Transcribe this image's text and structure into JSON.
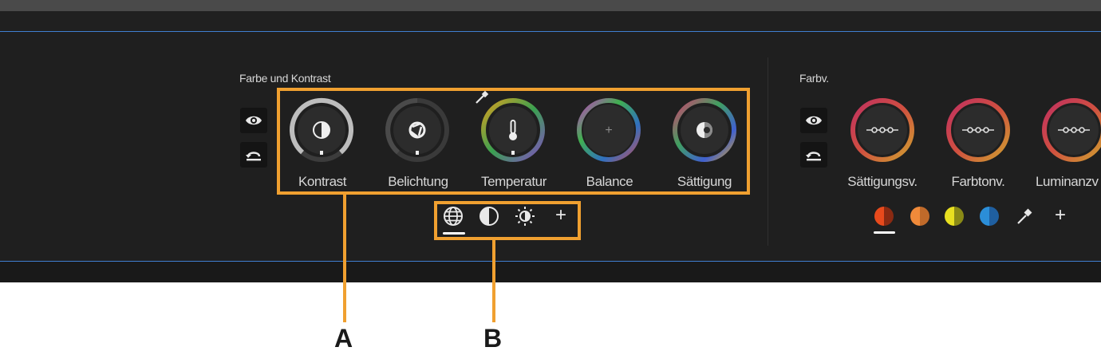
{
  "section_color": {
    "title": "Farbe und Kontrast",
    "dials": [
      {
        "name": "kontrast",
        "label": "Kontrast"
      },
      {
        "name": "belichtung",
        "label": "Belichtung"
      },
      {
        "name": "temperatur",
        "label": "Temperatur"
      },
      {
        "name": "balance",
        "label": "Balance"
      },
      {
        "name": "saettigung",
        "label": "Sättigung"
      }
    ],
    "balance_symbol": "+",
    "mode_add_symbol": "+"
  },
  "section_curves": {
    "title": "Farbv.",
    "dials": [
      {
        "name": "saettigungsv",
        "label": "Sättigungsv."
      },
      {
        "name": "farbtonv",
        "label": "Farbtonv."
      },
      {
        "name": "luminanzv",
        "label": "Luminanzv"
      }
    ],
    "add_symbol": "+",
    "swatches": [
      {
        "name": "red",
        "left": "#e84a1c",
        "right": "#8a2a12"
      },
      {
        "name": "orange",
        "left": "#f08a3a",
        "right": "#c06a2a"
      },
      {
        "name": "yellow",
        "left": "#e8e020",
        "right": "#8a8a16"
      },
      {
        "name": "blue",
        "left": "#2b8ed8",
        "right": "#1f5fa0"
      }
    ]
  },
  "callouts": {
    "a": "A",
    "b": "B"
  },
  "colors": {
    "accent_orange": "#f0a030",
    "panel_border": "#3f7fd0",
    "panel_bg": "#1f1f1f"
  },
  "icons": {
    "eye": "eye-icon",
    "reset": "reset-icon",
    "pipette": "eyedropper-icon",
    "globe": "globe-icon",
    "contrast": "half-circle-icon",
    "sun": "sun-icon"
  }
}
